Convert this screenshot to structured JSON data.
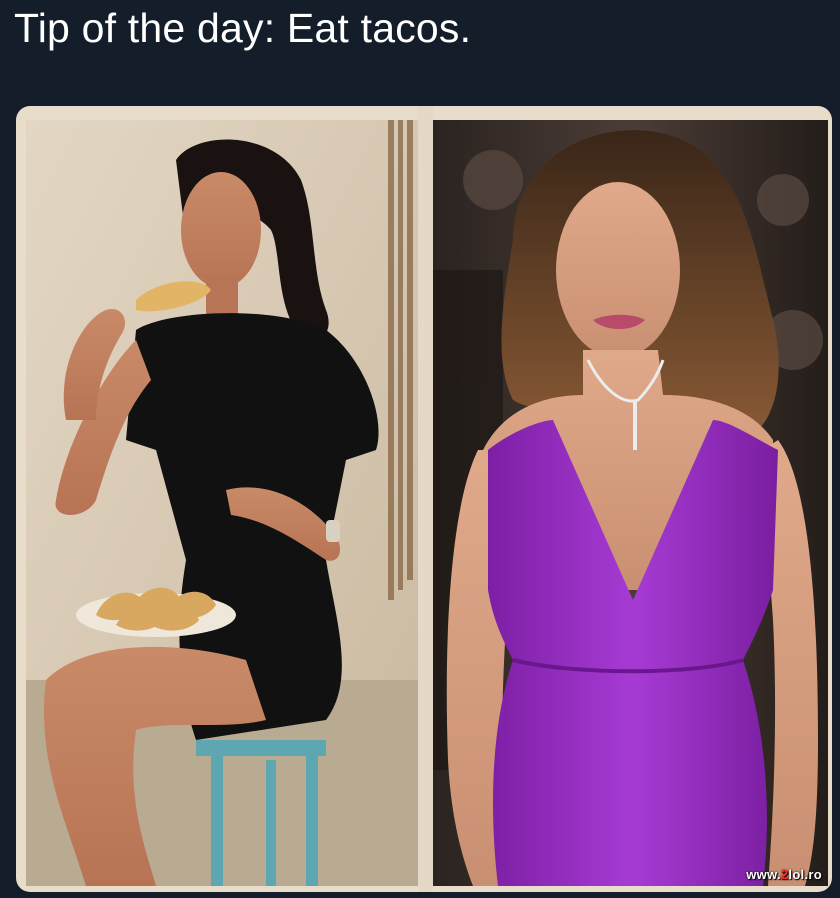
{
  "tweet": {
    "text": "Tip of the day: Eat tacos."
  },
  "media": {
    "left_photo": {
      "subject": "woman in black dress eating a taco, seated on a stool with a plate of tacos"
    },
    "right_photo": {
      "subject": "woman in purple dress with necklace at red carpet"
    }
  },
  "watermark": {
    "prefix": "www.",
    "brand_number": "2",
    "brand_rest": "lol",
    "suffix": ".ro"
  },
  "colors": {
    "background": "#141d2a",
    "text": "#ffffff",
    "dress_purple": "#9b2fc4",
    "dress_black": "#111111"
  }
}
